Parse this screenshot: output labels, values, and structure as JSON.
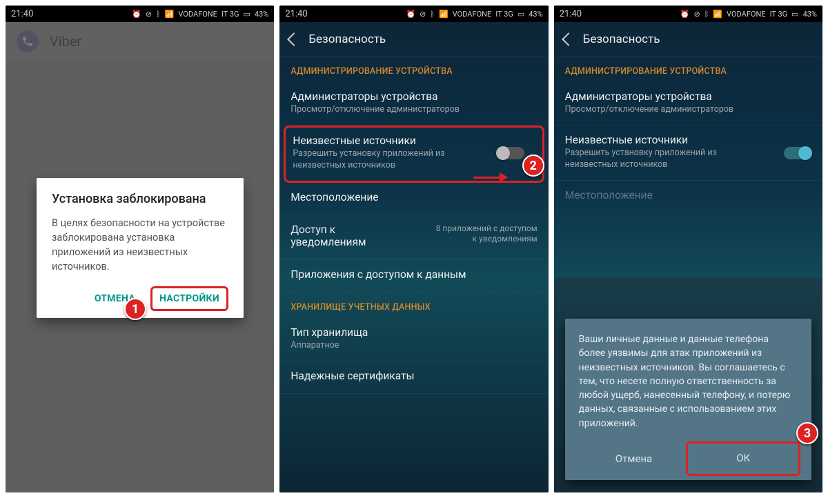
{
  "status": {
    "time": "21:40",
    "carrier": "VODAFONE",
    "network": "IT 3G",
    "battery": "43%"
  },
  "phone1": {
    "app_title": "Viber",
    "dialog": {
      "title": "Установка заблокирована",
      "body": "В целях безопасности на устройстве заблокирована установка приложений из неизвестных источников.",
      "cancel": "ОТМЕНА",
      "settings": "НАСТРОЙКИ"
    }
  },
  "security": {
    "title": "Безопасность",
    "section_admin": "АДМИНИСТРИРОВАНИЕ УСТРОЙСТВА",
    "device_admin": {
      "title": "Администраторы устройства",
      "sub": "Просмотр/отключение администраторов"
    },
    "unknown": {
      "title": "Неизвестные источники",
      "sub": "Разрешить установку приложений из неизвестных источников"
    },
    "location": {
      "title": "Местоположение"
    },
    "notif": {
      "title": "Доступ к уведомлениям",
      "right": "8 приложений с доступом к уведомлениям"
    },
    "data_access": {
      "title": "Приложения с доступом к данным"
    },
    "section_storage": "ХРАНИЛИЩЕ УЧЕТНЫХ ДАННЫХ",
    "storage_type": {
      "title": "Тип хранилища",
      "sub": "Аппаратное"
    },
    "trusted": {
      "title": "Надежные сертификаты"
    }
  },
  "phone3": {
    "dialog": {
      "body": "Ваши личные данные и данные телефона более уязвимы для атак приложений из неизвестных источников. Вы соглашаетесь с тем, что несете полную ответственность за любой ущерб, нанесенный телефону, и потерю данных, связанные с использованием этих приложений.",
      "cancel": "Отмена",
      "ok": "ОК"
    }
  },
  "markers": {
    "m1": "1",
    "m2": "2",
    "m3": "3"
  }
}
